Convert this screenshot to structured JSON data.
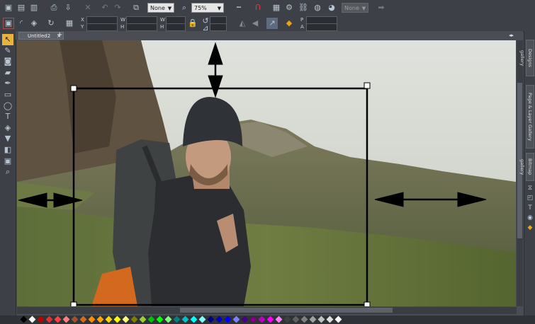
{
  "toolbar1": {
    "fill_dropdown": "None",
    "zoom_value": "75%",
    "right_dropdown": "None"
  },
  "toolbar2": {
    "labels": [
      "X",
      "Y",
      "W",
      "H",
      "W",
      "H",
      "P",
      "A"
    ]
  },
  "document": {
    "tab_title": "Untitled2",
    "add_tab": "+"
  },
  "side_panels": {
    "designs": "Designs gallery",
    "page_layer": "Page & Layer Gallery",
    "bitmap": "Bitmap gallery"
  },
  "left_tools": [
    "selector-tool-icon",
    "freehand-tool-icon",
    "photo-tool-icon",
    "eraser-tool-icon",
    "pen-tool-icon",
    "rectangle-tool-icon",
    "ellipse-tool-icon",
    "text-tool-icon",
    "fill-tool-icon",
    "transparency-tool-icon",
    "shadow-tool-icon",
    "bevel-tool-icon",
    "zoom-tool-icon"
  ],
  "colors": {
    "chrome": "#3d4147",
    "accent": "#e8a317"
  }
}
